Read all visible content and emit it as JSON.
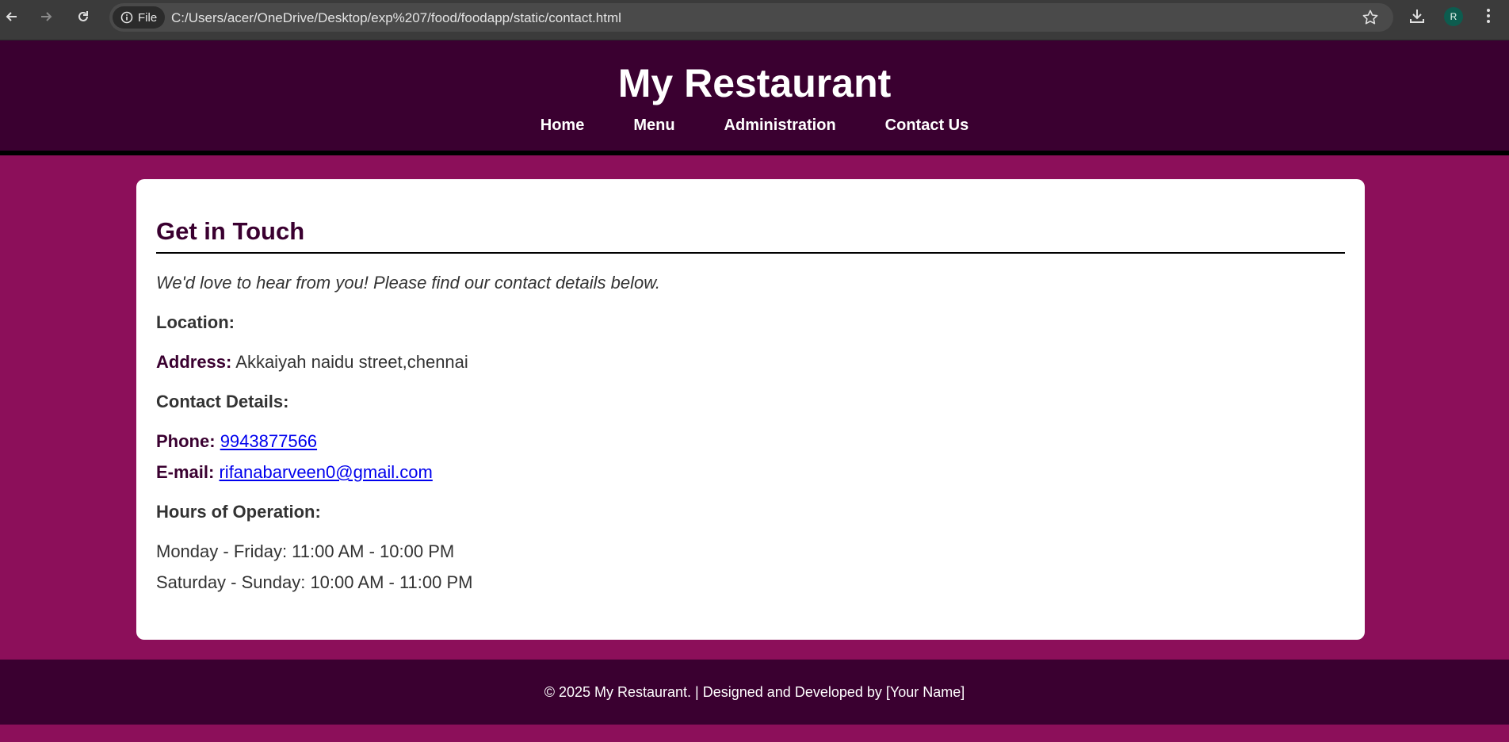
{
  "browser": {
    "site_chip_label": "File",
    "url": "C:/Users/acer/OneDrive/Desktop/exp%207/food/foodapp/static/contact.html",
    "avatar_letter": "R"
  },
  "header": {
    "title": "My Restaurant",
    "nav": [
      "Home",
      "Menu",
      "Administration",
      "Contact Us"
    ]
  },
  "contact": {
    "heading": "Get in Touch",
    "intro": "We'd love to hear from you! Please find our contact details below.",
    "location_heading": "Location:",
    "address_label": "Address:",
    "address_value": "Akkaiyah naidu street,chennai",
    "details_heading": "Contact Details:",
    "phone_label": "Phone:",
    "phone_value": "9943877566",
    "email_label": "E-mail:",
    "email_value": "rifanabarveen0@gmail.com",
    "hours_heading": "Hours of Operation:",
    "hours": [
      "Monday - Friday: 11:00 AM - 10:00 PM",
      "Saturday - Sunday: 10:00 AM - 11:00 PM"
    ]
  },
  "footer": {
    "text": "© 2025 My Restaurant. | Designed and Developed by [Your Name]"
  },
  "colors": {
    "page_bg": "#8c0f5a",
    "header_bg": "#3a0030",
    "link": "#0000ee"
  }
}
